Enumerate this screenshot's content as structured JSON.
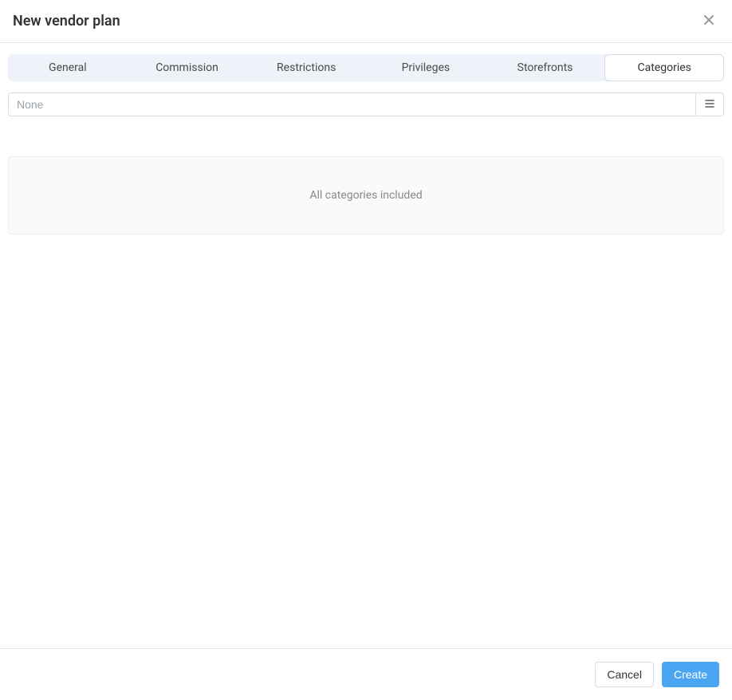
{
  "header": {
    "title": "New vendor plan"
  },
  "tabs": [
    {
      "label": "General"
    },
    {
      "label": "Commission"
    },
    {
      "label": "Restrictions"
    },
    {
      "label": "Privileges"
    },
    {
      "label": "Storefronts"
    },
    {
      "label": "Categories",
      "active": true
    }
  ],
  "search": {
    "placeholder": "None",
    "value": ""
  },
  "empty_state": {
    "message": "All categories included"
  },
  "footer": {
    "cancel_label": "Cancel",
    "create_label": "Create"
  }
}
